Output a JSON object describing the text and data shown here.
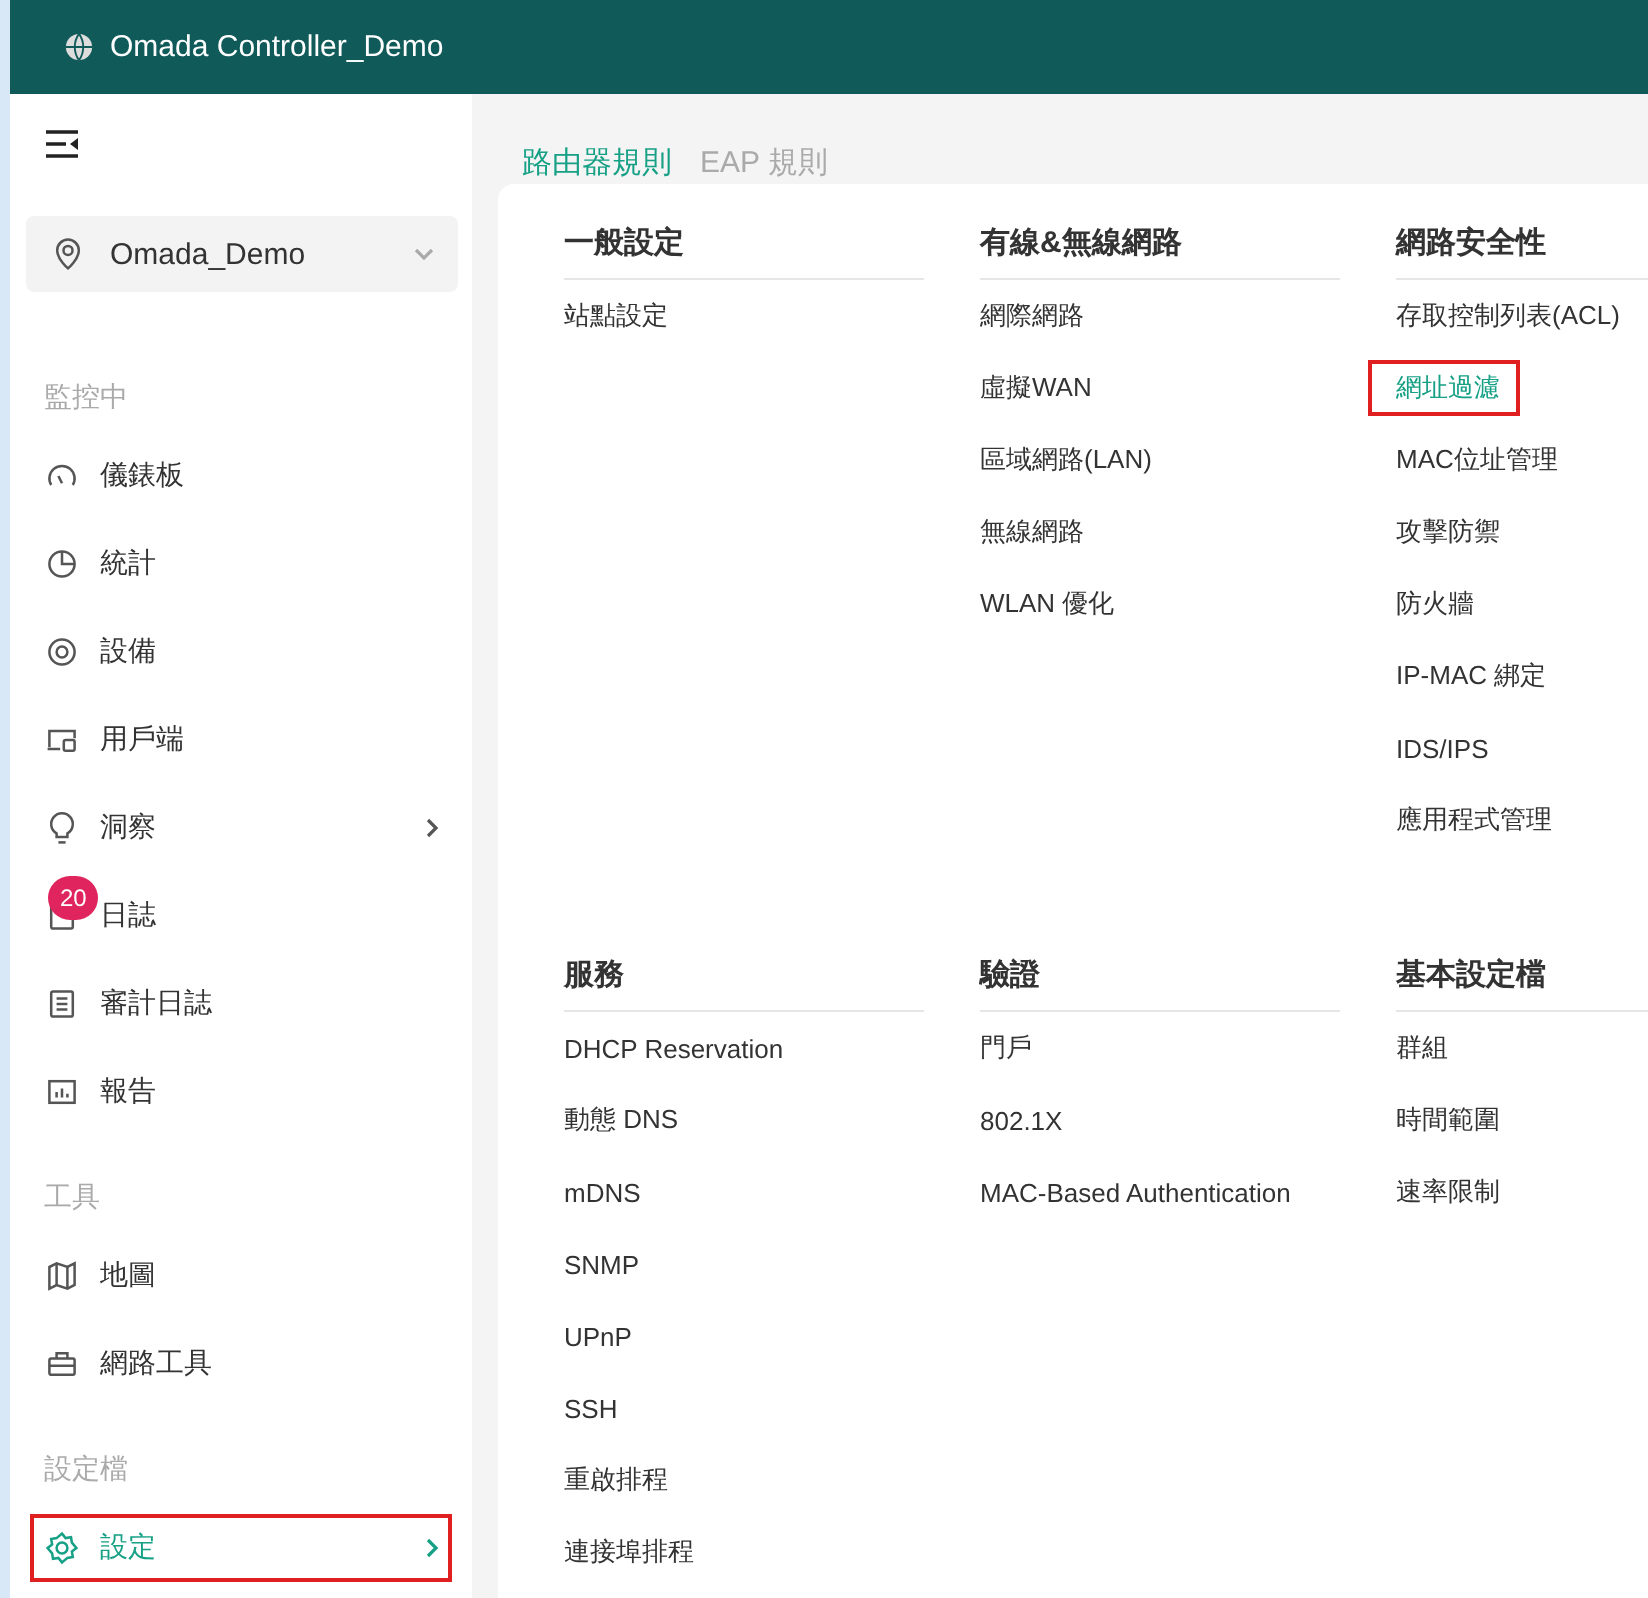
{
  "window": {
    "title": "Omada Controller_Demo"
  },
  "sidebar": {
    "site": "Omada_Demo",
    "sections": [
      {
        "heading": "監控中",
        "items": [
          {
            "label": "儀錶板",
            "selected": false,
            "expandable": false,
            "highlighted": false
          },
          {
            "label": "統計",
            "selected": false,
            "expandable": false,
            "highlighted": false
          },
          {
            "label": "設備",
            "selected": false,
            "expandable": false,
            "highlighted": false
          },
          {
            "label": "用戶端",
            "selected": false,
            "expandable": false,
            "highlighted": false
          },
          {
            "label": "洞察",
            "selected": false,
            "expandable": true,
            "highlighted": false
          },
          {
            "label": "日誌",
            "selected": false,
            "expandable": false,
            "highlighted": false,
            "badge": "20"
          },
          {
            "label": "審計日誌",
            "selected": false,
            "expandable": false,
            "highlighted": false
          },
          {
            "label": "報告",
            "selected": false,
            "expandable": false,
            "highlighted": false
          }
        ]
      },
      {
        "heading": "工具",
        "items": [
          {
            "label": "地圖",
            "selected": false,
            "expandable": false,
            "highlighted": false
          },
          {
            "label": "網路工具",
            "selected": false,
            "expandable": false,
            "highlighted": false
          }
        ]
      },
      {
        "heading": "設定檔",
        "items": [
          {
            "label": "設定",
            "selected": true,
            "expandable": true,
            "highlighted": true
          }
        ]
      }
    ]
  },
  "tabs": [
    {
      "label": "路由器規則",
      "selected": true
    },
    {
      "label": "EAP 規則",
      "selected": false
    }
  ],
  "groups": [
    {
      "heading": "一般設定",
      "items": [
        {
          "label": "站點設定",
          "selected": false,
          "highlighted": false
        }
      ]
    },
    {
      "heading": "有線&無線網路",
      "items": [
        {
          "label": "網際網路",
          "selected": false,
          "highlighted": false
        },
        {
          "label": "虛擬WAN",
          "selected": false,
          "highlighted": false
        },
        {
          "label": "區域網路(LAN)",
          "selected": false,
          "highlighted": false
        },
        {
          "label": "無線網路",
          "selected": false,
          "highlighted": false
        },
        {
          "label": "WLAN 優化",
          "selected": false,
          "highlighted": false
        }
      ]
    },
    {
      "heading": "網路安全性",
      "items": [
        {
          "label": "存取控制列表(ACL)",
          "selected": false,
          "highlighted": false
        },
        {
          "label": "網址過濾",
          "selected": true,
          "highlighted": true
        },
        {
          "label": "MAC位址管理",
          "selected": false,
          "highlighted": false
        },
        {
          "label": "攻擊防禦",
          "selected": false,
          "highlighted": false
        },
        {
          "label": "防火牆",
          "selected": false,
          "highlighted": false
        },
        {
          "label": "IP-MAC 綁定",
          "selected": false,
          "highlighted": false
        },
        {
          "label": "IDS/IPS",
          "selected": false,
          "highlighted": false
        },
        {
          "label": "應用程式管理",
          "selected": false,
          "highlighted": false
        }
      ]
    },
    {
      "heading": "服務",
      "items": [
        {
          "label": "DHCP Reservation",
          "selected": false,
          "highlighted": false
        },
        {
          "label": "動態 DNS",
          "selected": false,
          "highlighted": false
        },
        {
          "label": "mDNS",
          "selected": false,
          "highlighted": false
        },
        {
          "label": "SNMP",
          "selected": false,
          "highlighted": false
        },
        {
          "label": "UPnP",
          "selected": false,
          "highlighted": false
        },
        {
          "label": "SSH",
          "selected": false,
          "highlighted": false
        },
        {
          "label": "重啟排程",
          "selected": false,
          "highlighted": false
        },
        {
          "label": "連接埠排程",
          "selected": false,
          "highlighted": false
        }
      ]
    },
    {
      "heading": "驗證",
      "items": [
        {
          "label": "門戶",
          "selected": false,
          "highlighted": false
        },
        {
          "label": "802.1X",
          "selected": false,
          "highlighted": false
        },
        {
          "label": "MAC-Based Authentication",
          "selected": false,
          "highlighted": false
        }
      ]
    },
    {
      "heading": "基本設定檔",
      "items": [
        {
          "label": "群組",
          "selected": false,
          "highlighted": false
        },
        {
          "label": "時間範圍",
          "selected": false,
          "highlighted": false
        },
        {
          "label": "速率限制",
          "selected": false,
          "highlighted": false
        }
      ]
    }
  ]
}
